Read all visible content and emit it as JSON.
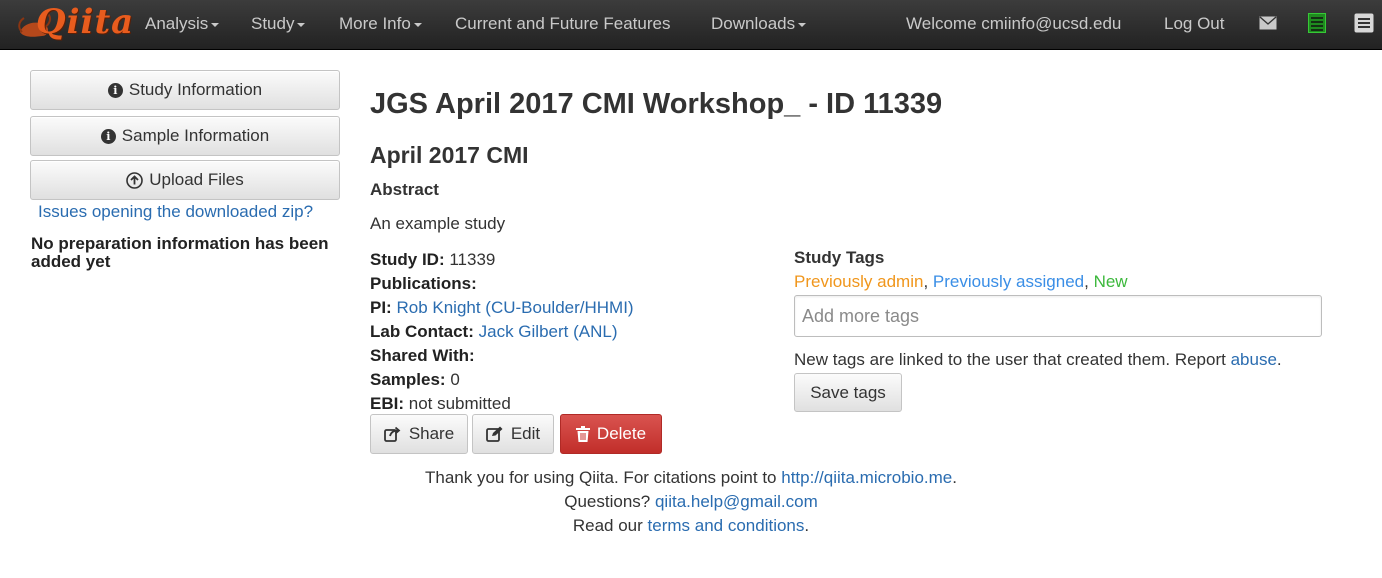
{
  "brand": {
    "name": "Qiita",
    "color": "#e85c1e"
  },
  "nav": {
    "analysis": "Analysis",
    "study": "Study",
    "more_info": "More Info",
    "features": "Current and Future Features",
    "downloads": "Downloads",
    "welcome": "Welcome cmiinfo@ucsd.edu",
    "logout": "Log Out",
    "icons": [
      "envelope-icon",
      "list-icon",
      "menu-icon"
    ]
  },
  "sidebar": {
    "study_info": "Study Information",
    "sample_info": "Sample Information",
    "upload": "Upload Files",
    "zip_link": "Issues opening the downloaded zip?",
    "prep_note": "No preparation information has been added yet"
  },
  "study": {
    "title": "JGS April 2017 CMI Workshop_ - ID 11339",
    "alias": "April 2017 CMI",
    "abstract_label": "Abstract",
    "abstract": "An example study",
    "study_id_label": "Study ID:",
    "study_id": "11339",
    "publications_label": "Publications:",
    "pi_label": "PI:",
    "pi": "Rob Knight (CU-Boulder/HHMI)",
    "lab_contact_label": "Lab Contact:",
    "lab_contact": "Jack Gilbert (ANL)",
    "shared_label": "Shared With:",
    "samples_label": "Samples:",
    "samples": "0",
    "ebi_label": "EBI:",
    "ebi": "not submitted"
  },
  "actions": {
    "share": "Share",
    "edit": "Edit",
    "delete": "Delete"
  },
  "tags": {
    "title": "Study Tags",
    "legend_admin": "Previously admin",
    "legend_sep1": ", ",
    "legend_assigned": "Previously assigned",
    "legend_sep2": ", ",
    "legend_new": "New",
    "colors": {
      "admin": "#f0961c",
      "assigned": "#3a8ee6",
      "new": "#3cb83c"
    },
    "placeholder": "Add more tags",
    "note": "New tags are linked to the user that created them. Report ",
    "abuse": "abuse",
    "note_end": ".",
    "save": "Save tags"
  },
  "footer": {
    "thanks": "Thank you for using Qiita. For citations point to ",
    "url": "http://qiita.microbio.me",
    "thanks_end": ".",
    "questions": "Questions? ",
    "email": "qiita.help@gmail.com",
    "read": "Read our ",
    "terms": "terms and conditions",
    "read_end": "."
  }
}
